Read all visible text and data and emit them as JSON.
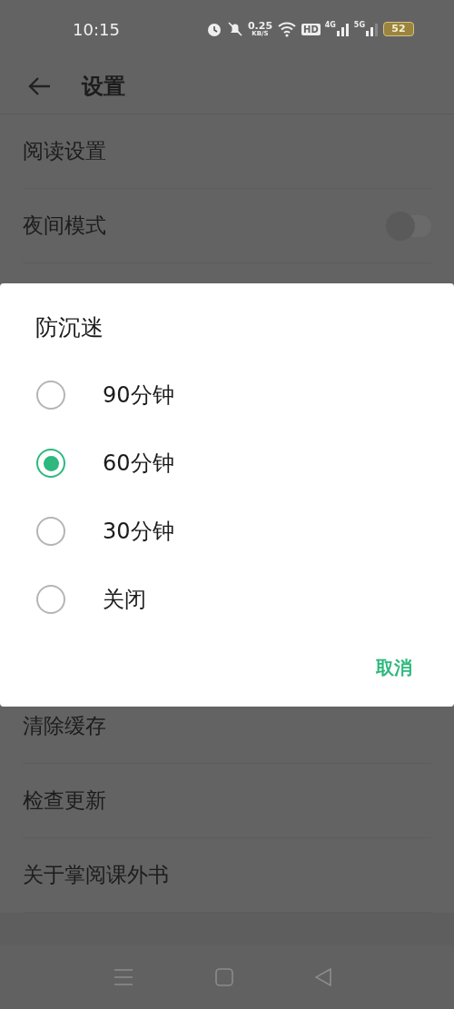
{
  "status_bar": {
    "time": "10:15",
    "speed_value": "0.25",
    "speed_unit": "KB/S",
    "hd": "HD",
    "signal_1": "4G",
    "signal_2": "5G",
    "battery": "52"
  },
  "header": {
    "title": "设置"
  },
  "settings": [
    {
      "kind": "plain",
      "label": "阅读设置"
    },
    {
      "kind": "switch",
      "label": "夜间模式",
      "on": false
    },
    {
      "kind": "hidden"
    },
    {
      "kind": "plain",
      "label": "清除缓存"
    },
    {
      "kind": "plain",
      "label": "检查更新"
    },
    {
      "kind": "plain",
      "label": "关于掌阅课外书"
    }
  ],
  "dialog": {
    "title": "防沉迷",
    "options": [
      {
        "label": "90分钟",
        "selected": false
      },
      {
        "label": "60分钟",
        "selected": true
      },
      {
        "label": "30分钟",
        "selected": false
      },
      {
        "label": "关闭",
        "selected": false
      }
    ],
    "cancel": "取消"
  }
}
